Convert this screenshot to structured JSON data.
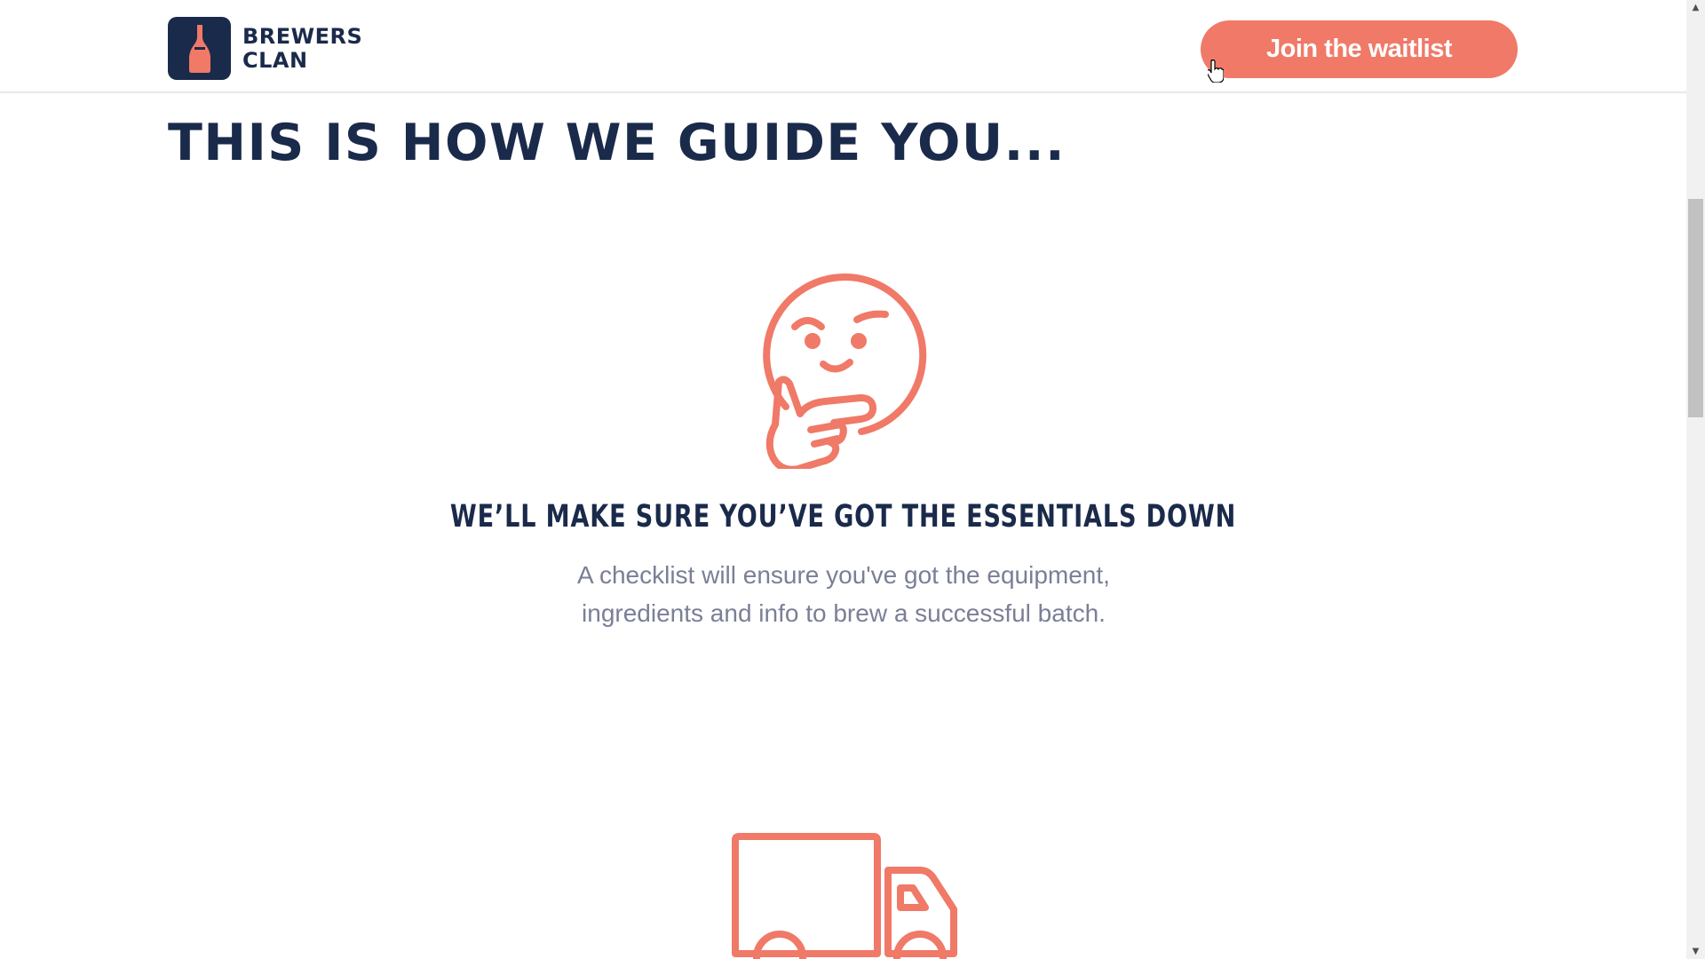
{
  "header": {
    "logo_line1": "BREWERS",
    "logo_line2": "CLAN",
    "cta_label": "Join the waitlist"
  },
  "main": {
    "section_title": "THIS IS HOW WE GUIDE YOU...",
    "features": [
      {
        "icon": "thinking-face-icon",
        "heading": "WE’LL MAKE SURE YOU’VE GOT THE ESSENTIALS DOWN",
        "text_line1": "A checklist will ensure you've got the equipment,",
        "text_line2": "ingredients and info to brew a successful batch."
      },
      {
        "icon": "delivery-truck-icon"
      }
    ]
  },
  "colors": {
    "navy": "#1a2a4a",
    "coral": "#f07968",
    "muted_text": "#7a7f96"
  }
}
